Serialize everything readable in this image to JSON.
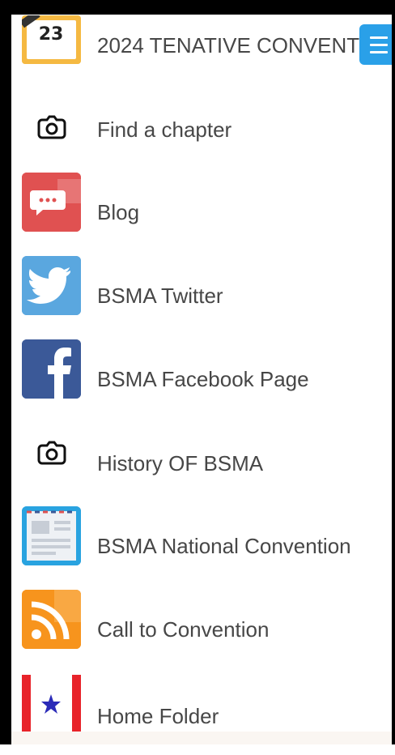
{
  "colors": {
    "menu_button": "#2aa0e8",
    "label_text": "#474747",
    "blog_red": "#e05151",
    "twitter_blue": "#5aa7df",
    "facebook_blue": "#3b5998",
    "rss_orange": "#f7941d",
    "canada_red": "#e8232a"
  },
  "calendar_badge": "23",
  "menu": {
    "items": [
      {
        "label": "2024 TENATIVE CONVENT",
        "icon": "calendar-icon"
      },
      {
        "label": "Find a chapter",
        "icon": "camera-icon"
      },
      {
        "label": "Blog",
        "icon": "chat-bubble-icon"
      },
      {
        "label": "BSMA Twitter",
        "icon": "twitter-icon"
      },
      {
        "label": "BSMA Facebook Page",
        "icon": "facebook-icon"
      },
      {
        "label": "History OF BSMA",
        "icon": "camera-icon"
      },
      {
        "label": "BSMA National Convention",
        "icon": "envelope-letter-icon"
      },
      {
        "label": "Call to Convention",
        "icon": "rss-icon"
      },
      {
        "label": "Home Folder",
        "icon": "flag-icon"
      }
    ]
  },
  "hamburger_icon": "hamburger-menu-icon"
}
